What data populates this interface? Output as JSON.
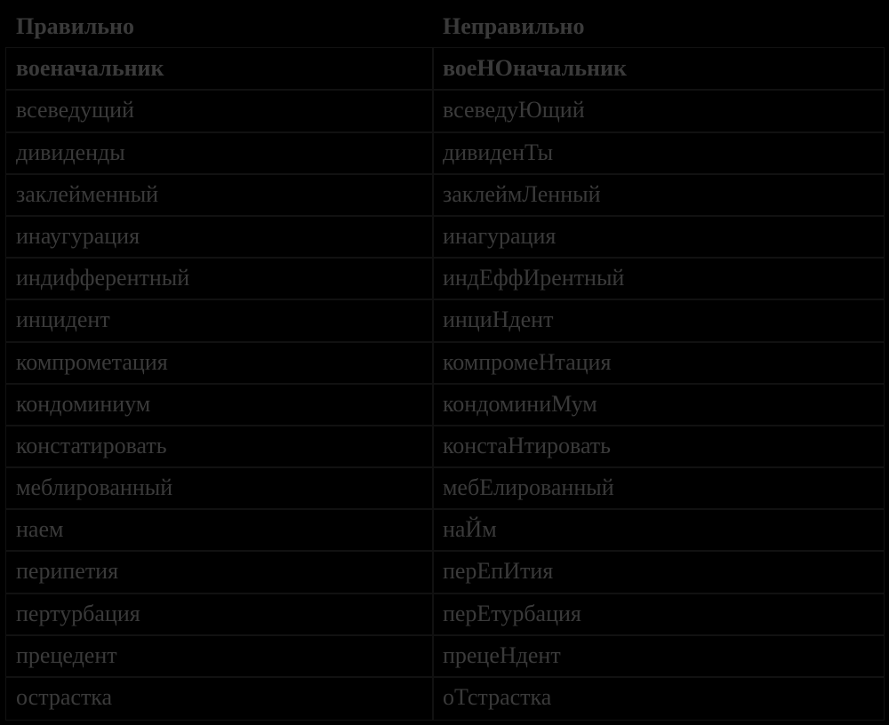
{
  "table": {
    "headers": {
      "correct": "Правильно",
      "incorrect": "Неправильно"
    },
    "rows": [
      {
        "correct": "военачальник",
        "incorrect": "воеНОначальник"
      },
      {
        "correct": "всеведущий",
        "incorrect": "всеведуЮщий"
      },
      {
        "correct": "дивиденды",
        "incorrect": "дивиденТы"
      },
      {
        "correct": "заклейменный",
        "incorrect": "заклеймЛенный"
      },
      {
        "correct": "инаугурация",
        "incorrect": "инагурация"
      },
      {
        "correct": "индифферентный",
        "incorrect": "индЕффИрентный"
      },
      {
        "correct": "инцидент",
        "incorrect": "инциНдент"
      },
      {
        "correct": "компрометация",
        "incorrect": "компромеНтация"
      },
      {
        "correct": "кондоминиум",
        "incorrect": "кондоминиМум"
      },
      {
        "correct": "констатировать",
        "incorrect": "констаНтировать"
      },
      {
        "correct": "меблированный",
        "incorrect": "мебЕлированный"
      },
      {
        "correct": "наем",
        "incorrect": "наЙм"
      },
      {
        "correct": "перипетия",
        "incorrect": "перЕпИтия"
      },
      {
        "correct": "пертурбация",
        "incorrect": "перЕтурбация"
      },
      {
        "correct": "прецедент",
        "incorrect": "прецеНдент"
      },
      {
        "correct": "острастка",
        "incorrect": "оТстрастка"
      }
    ]
  }
}
